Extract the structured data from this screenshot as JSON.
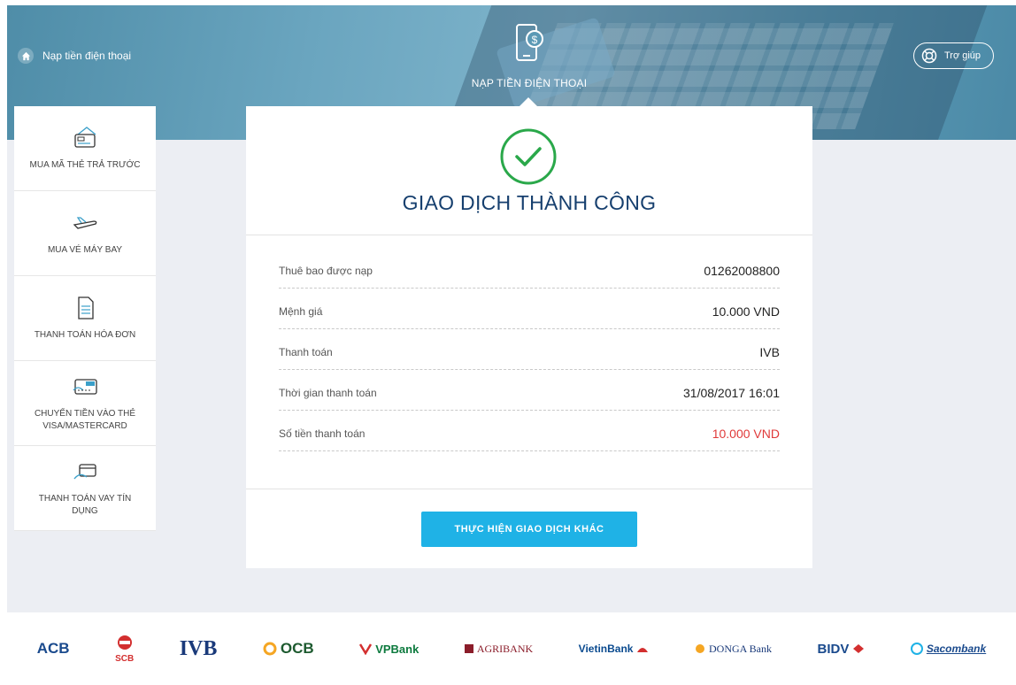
{
  "breadcrumb": {
    "home_label": "Nạp tiền điện thoại"
  },
  "hero": {
    "title": "NẠP TIỀN ĐIỆN THOẠI"
  },
  "help": {
    "label": "Trợ giúp"
  },
  "sidebar": {
    "items": [
      {
        "label": "MUA MÃ THẺ TRẢ TRƯỚC",
        "icon": "prepaid-card-icon"
      },
      {
        "label": "MUA VÉ MÁY BAY",
        "icon": "airplane-icon"
      },
      {
        "label": "THANH TOÁN HÓA ĐƠN",
        "icon": "bill-icon"
      },
      {
        "label": "CHUYỂN TIỀN VÀO THẺ VISA/MASTERCARD",
        "icon": "visa-card-icon"
      },
      {
        "label": "THANH TOÁN VAY TÍN DỤNG",
        "icon": "credit-payment-icon"
      }
    ]
  },
  "result": {
    "title": "GIAO DỊCH THÀNH CÔNG",
    "rows": [
      {
        "label": "Thuê bao được nạp",
        "value": "01262008800"
      },
      {
        "label": "Mệnh giá",
        "value": "10.000 VND"
      },
      {
        "label": "Thanh toán",
        "value": "IVB"
      },
      {
        "label": "Thời gian thanh toán",
        "value": "31/08/2017 16:01"
      },
      {
        "label": "Số tiền thanh toán",
        "value": "10.000 VND"
      }
    ],
    "button_label": "THỰC HIỆN GIAO DỊCH KHÁC"
  },
  "banks": [
    "ACB",
    "SCB",
    "IVB",
    "OCB",
    "VPBank",
    "AGRIBANK",
    "VietinBank",
    "DONGA Bank",
    "BIDV",
    "Sacombank"
  ],
  "colors": {
    "accent": "#1fb2e6",
    "title": "#163f6e",
    "success": "#2aa84a",
    "amount": "#e03a3a"
  }
}
